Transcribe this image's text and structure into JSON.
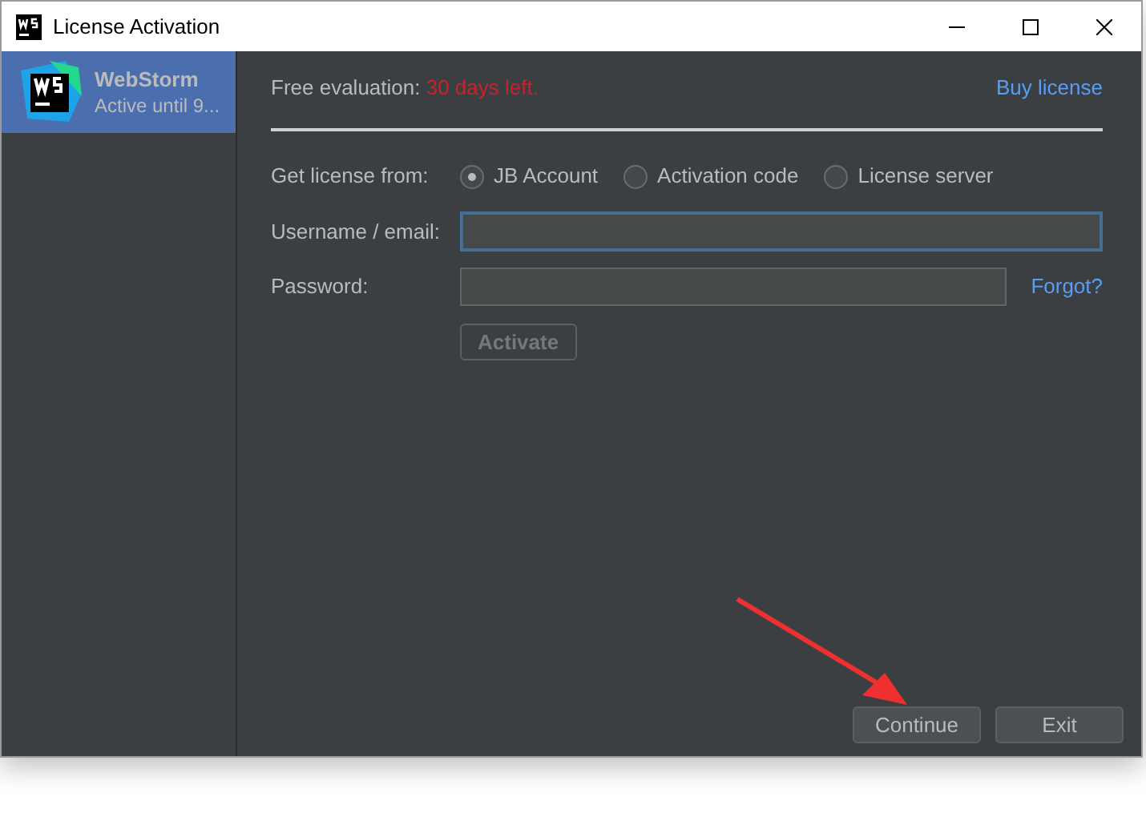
{
  "window": {
    "title": "License Activation"
  },
  "sidebar": {
    "items": [
      {
        "name": "WebStorm",
        "subtitle": "Active until 9...",
        "selected": true
      }
    ]
  },
  "evaluation": {
    "label": "Free evaluation:",
    "remaining": "30 days left."
  },
  "buy_link": "Buy license",
  "license_source": {
    "label": "Get license from:",
    "options": [
      {
        "label": "JB Account",
        "selected": true
      },
      {
        "label": "Activation code",
        "selected": false
      },
      {
        "label": "License server",
        "selected": false
      }
    ]
  },
  "username": {
    "label": "Username / email:",
    "focused": true
  },
  "password": {
    "label": "Password:",
    "forgot_link": "Forgot?"
  },
  "activate_button": {
    "label": "Activate",
    "disabled": true
  },
  "buttons": [
    "Continue",
    "Exit"
  ]
}
